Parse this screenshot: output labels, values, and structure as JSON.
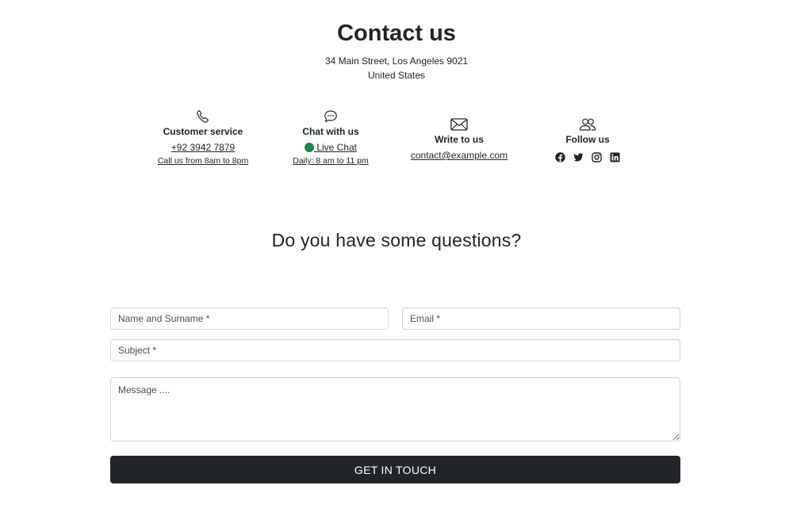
{
  "header": {
    "title": "Contact us",
    "address_line1": "34 Main Street, Los Angeles 9021",
    "address_line2": "United States"
  },
  "contacts": {
    "customer_service": {
      "icon": "phone-icon",
      "heading": "Customer service",
      "phone": "+92 3942 7879",
      "hours": "Call us from 8am to 8pm"
    },
    "chat": {
      "icon": "chat-bubble-icon",
      "heading": "Chat with us",
      "link": " Live Chat",
      "hours": "Daily: 8 am to 11 pm",
      "status_color": "#198754"
    },
    "write": {
      "icon": "envelope-icon",
      "heading": "Write to us",
      "email": "contact@example.com"
    },
    "follow": {
      "icon": "people-icon",
      "heading": "Follow us",
      "networks": [
        "facebook-icon",
        "twitter-icon",
        "instagram-icon",
        "linkedin-icon"
      ]
    }
  },
  "form": {
    "heading": "Do you have some questions?",
    "name_placeholder": "Name and Surname *",
    "email_placeholder": "Email *",
    "subject_placeholder": "Subject *",
    "message_placeholder": "Message ....",
    "submit_label": "GET IN TOUCH",
    "button_color": "#212529"
  }
}
